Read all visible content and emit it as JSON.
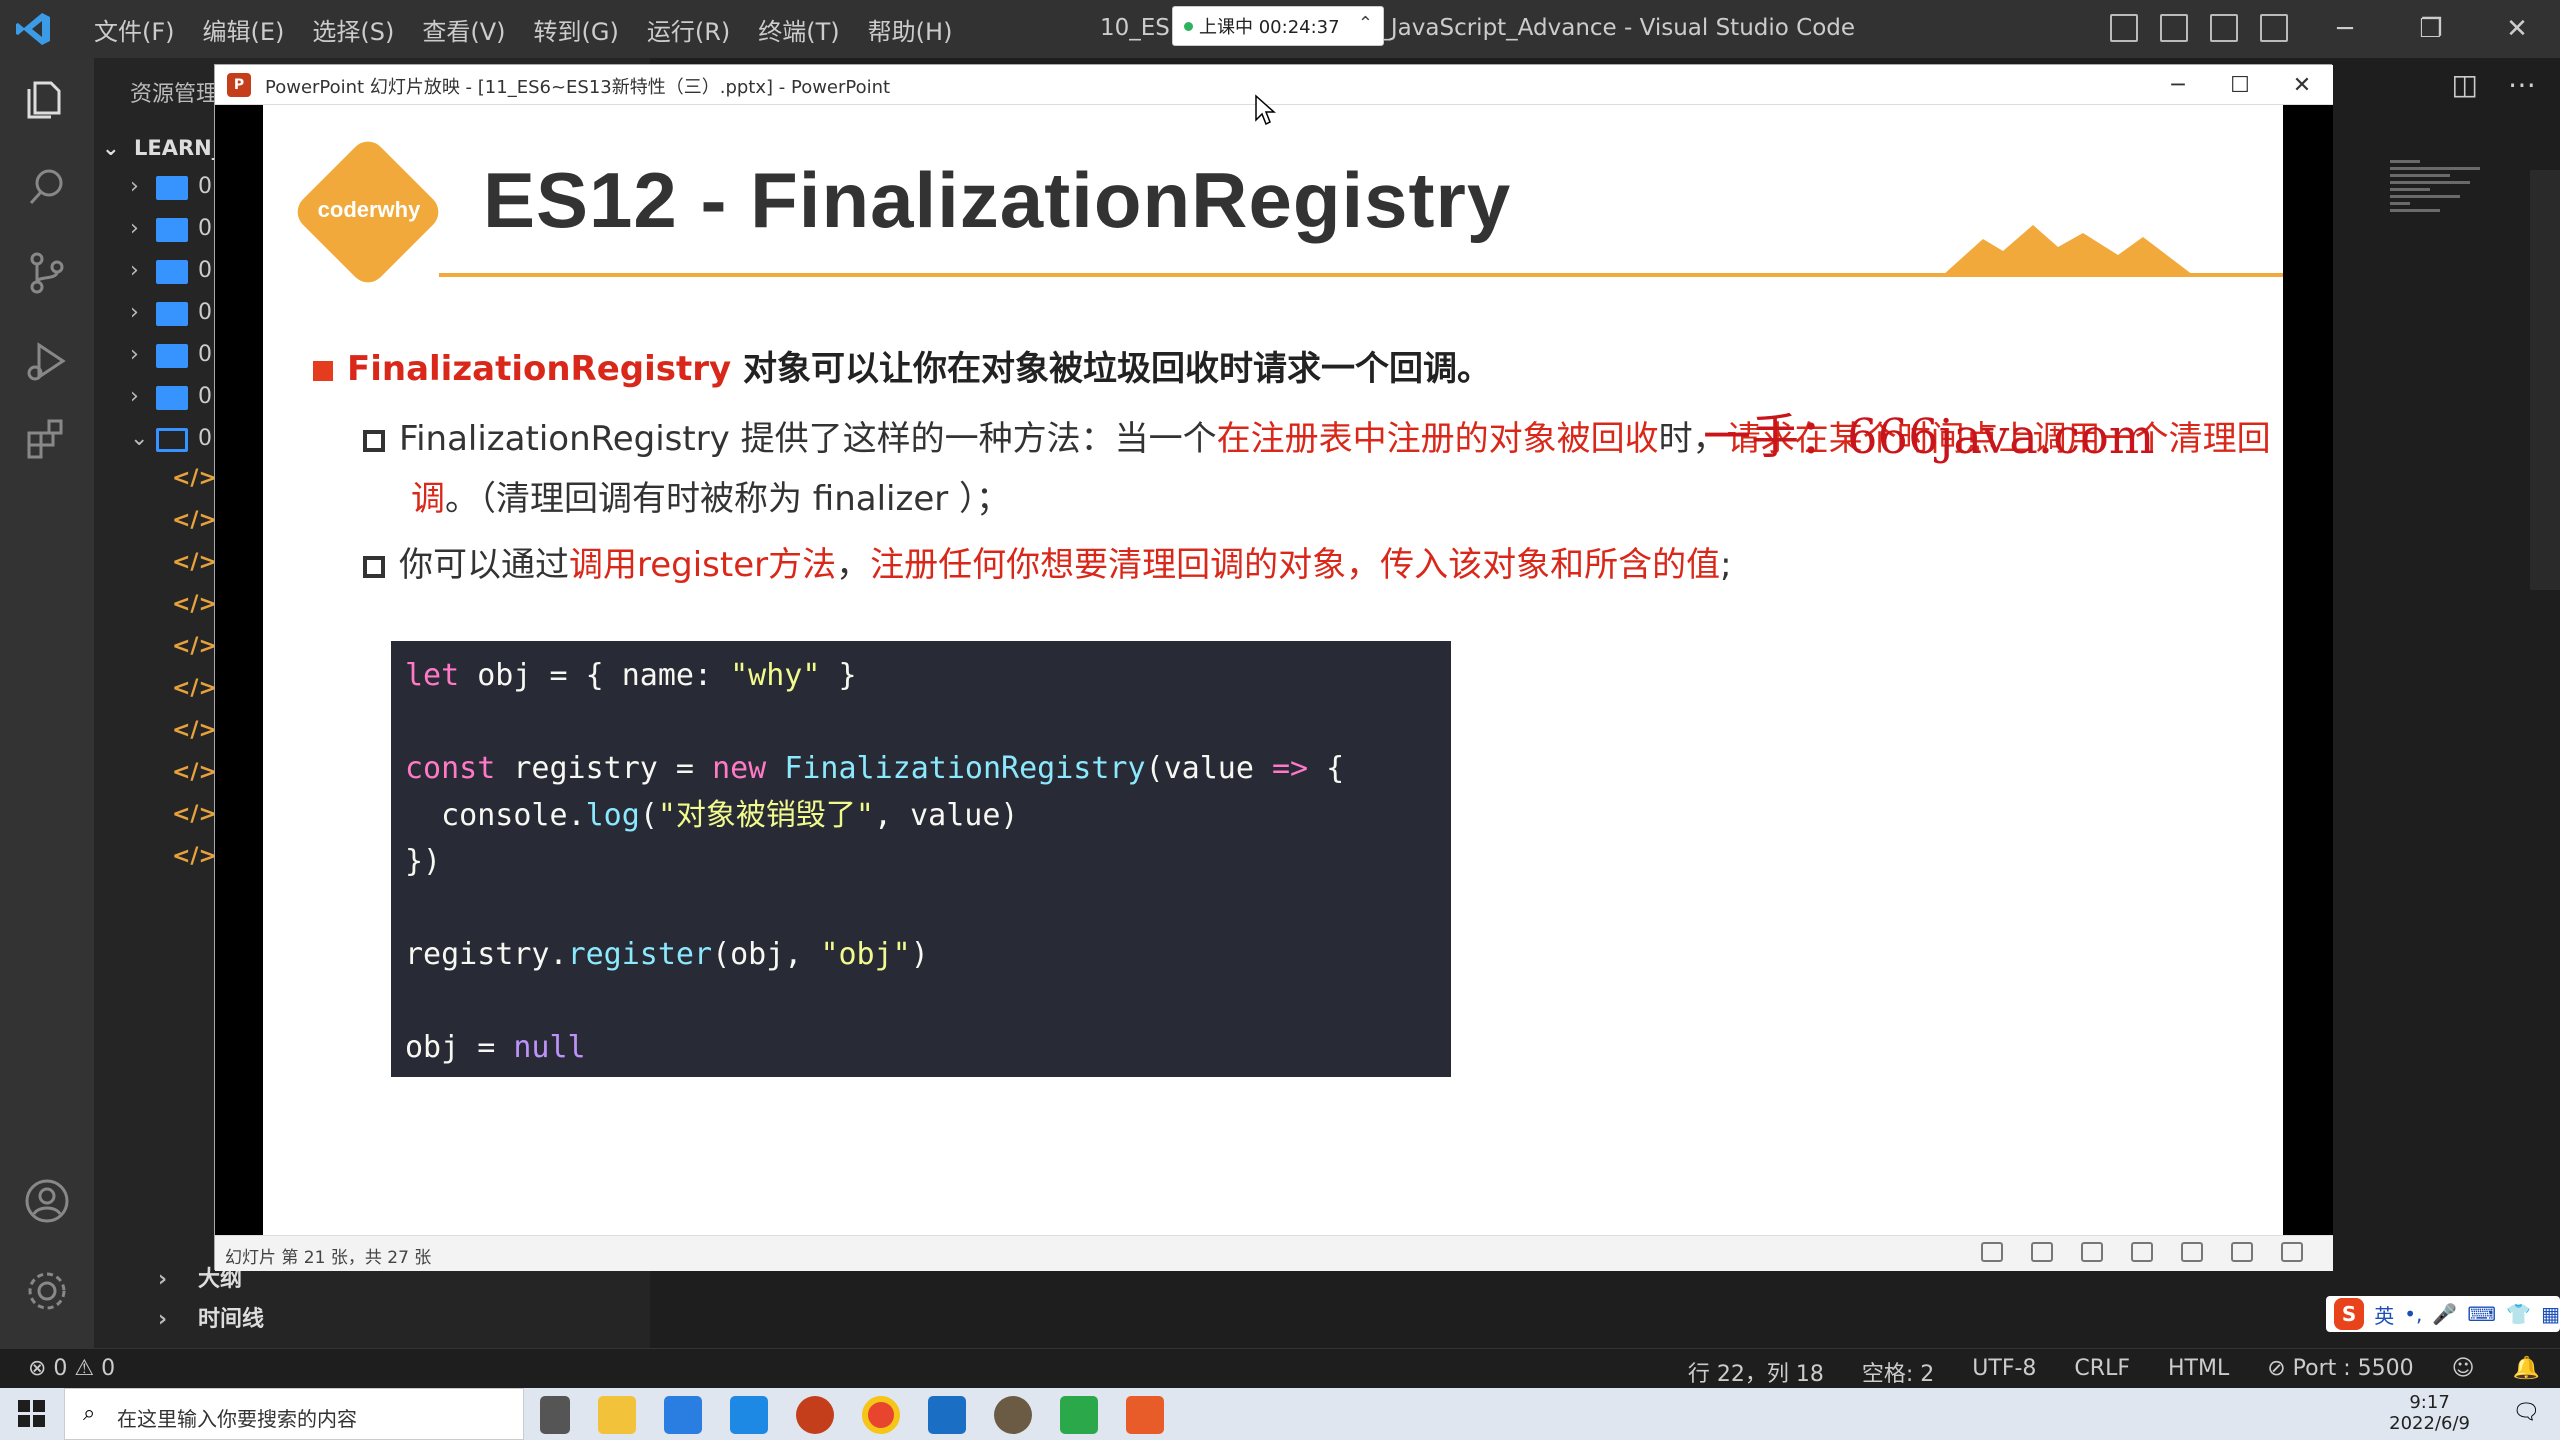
{
  "vscode": {
    "menu": [
      "文件(F)",
      "编辑(E)",
      "选择(S)",
      "查看(V)",
      "转到(G)",
      "运行(R)",
      "终端(T)",
      "帮助(H)"
    ],
    "window_title": "10_ES1 … y.html - Learn_JavaScript_Advance - Visual Studio Code",
    "recording": {
      "label": "上课中 00:24:37"
    },
    "sidebar": {
      "header": "资源管理",
      "root": "LEARN_J",
      "folders": [
        "0",
        "0",
        "0",
        "0",
        "0",
        "0",
        "0"
      ],
      "files_tag": "</>",
      "outline": "大纲",
      "timeline": "时间线"
    },
    "statusbar": {
      "errors": "⊗ 0 ⚠ 0",
      "position": "行 22，列 18",
      "spaces": "空格: 2",
      "encoding": "UTF-8",
      "eol": "CRLF",
      "language": "HTML",
      "port": "⊘ Port : 5500"
    }
  },
  "ppt": {
    "title": "PowerPoint 幻灯片放映 - [11_ES6~ES13新特性（三）.pptx] - PowerPoint",
    "status": "幻灯片 第 21 张，共 27 张",
    "slide": {
      "logo": "coderwhy",
      "title": "ES12 - FinalizationRegistry",
      "bullet_main_red": "FinalizationRegistry",
      "bullet_main_rest": " 对象可以让你在对象被垃圾回收时请求一个回调。",
      "sub1_a": "FinalizationRegistry 提供了这样的一种方法：当一个",
      "sub1_red": "在注册表中注册的对象被回收",
      "sub1_b": "时，",
      "sub1_red2": "请求在某个时间点上调用一个清理回",
      "sub1_line2_red": "调",
      "sub1_line2": "。（清理回调有时被称为 finalizer ）；",
      "sub2_a": "你可以通过",
      "sub2_red1": "调用register方法",
      "sub2_b": "，",
      "sub2_red2": "注册任何你想要清理回调的对象，传入该对象和所含的值",
      "sub2_c": ";",
      "watermark": "一手：666java.com"
    },
    "code": [
      "let obj = { name: \"why\" }",
      "",
      "const registry = new FinalizationRegistry(value => {",
      "  console.log(\"对象被销毁了\", value)",
      "})",
      "",
      "registry.register(obj, \"obj\")",
      "",
      "obj = null"
    ]
  },
  "taskbar": {
    "search_placeholder": "在这里输入你要搜索的内容",
    "time": "9:17",
    "date": "2022/6/9",
    "ime": "英"
  }
}
